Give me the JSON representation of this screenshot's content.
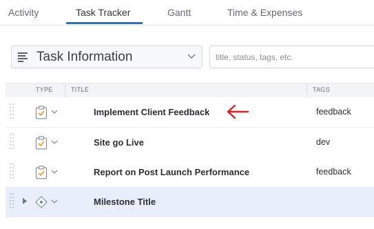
{
  "tabs": [
    {
      "label": "Activity",
      "active": false
    },
    {
      "label": "Task Tracker",
      "active": true
    },
    {
      "label": "Gantt",
      "active": false
    },
    {
      "label": "Time & Expenses",
      "active": false
    }
  ],
  "toolbar": {
    "view_select": {
      "label": "Task Information",
      "icon": "list-icon"
    },
    "search": {
      "placeholder": "title, status, tags, etc.",
      "value": ""
    }
  },
  "table": {
    "headers": {
      "type": "TYPE",
      "title": "TITLE",
      "tags": "TAGS"
    },
    "rows": [
      {
        "type": "task",
        "title": "Implement Client Feedback",
        "tags": "feedback"
      },
      {
        "type": "task",
        "title": "Site go Live",
        "tags": "dev"
      },
      {
        "type": "task",
        "title": "Report on Post Launch Performance",
        "tags": "feedback"
      },
      {
        "type": "milestone",
        "title": "Milestone Title",
        "tags": ""
      }
    ]
  },
  "annotation": {
    "icon": "red-arrow-left-icon",
    "color": "#e02020"
  },
  "colors": {
    "accent": "#2f6fad",
    "task_icon": "#e8a23a",
    "milestone_icon": "#3a86c8",
    "milestone_row": "#e9effa"
  }
}
